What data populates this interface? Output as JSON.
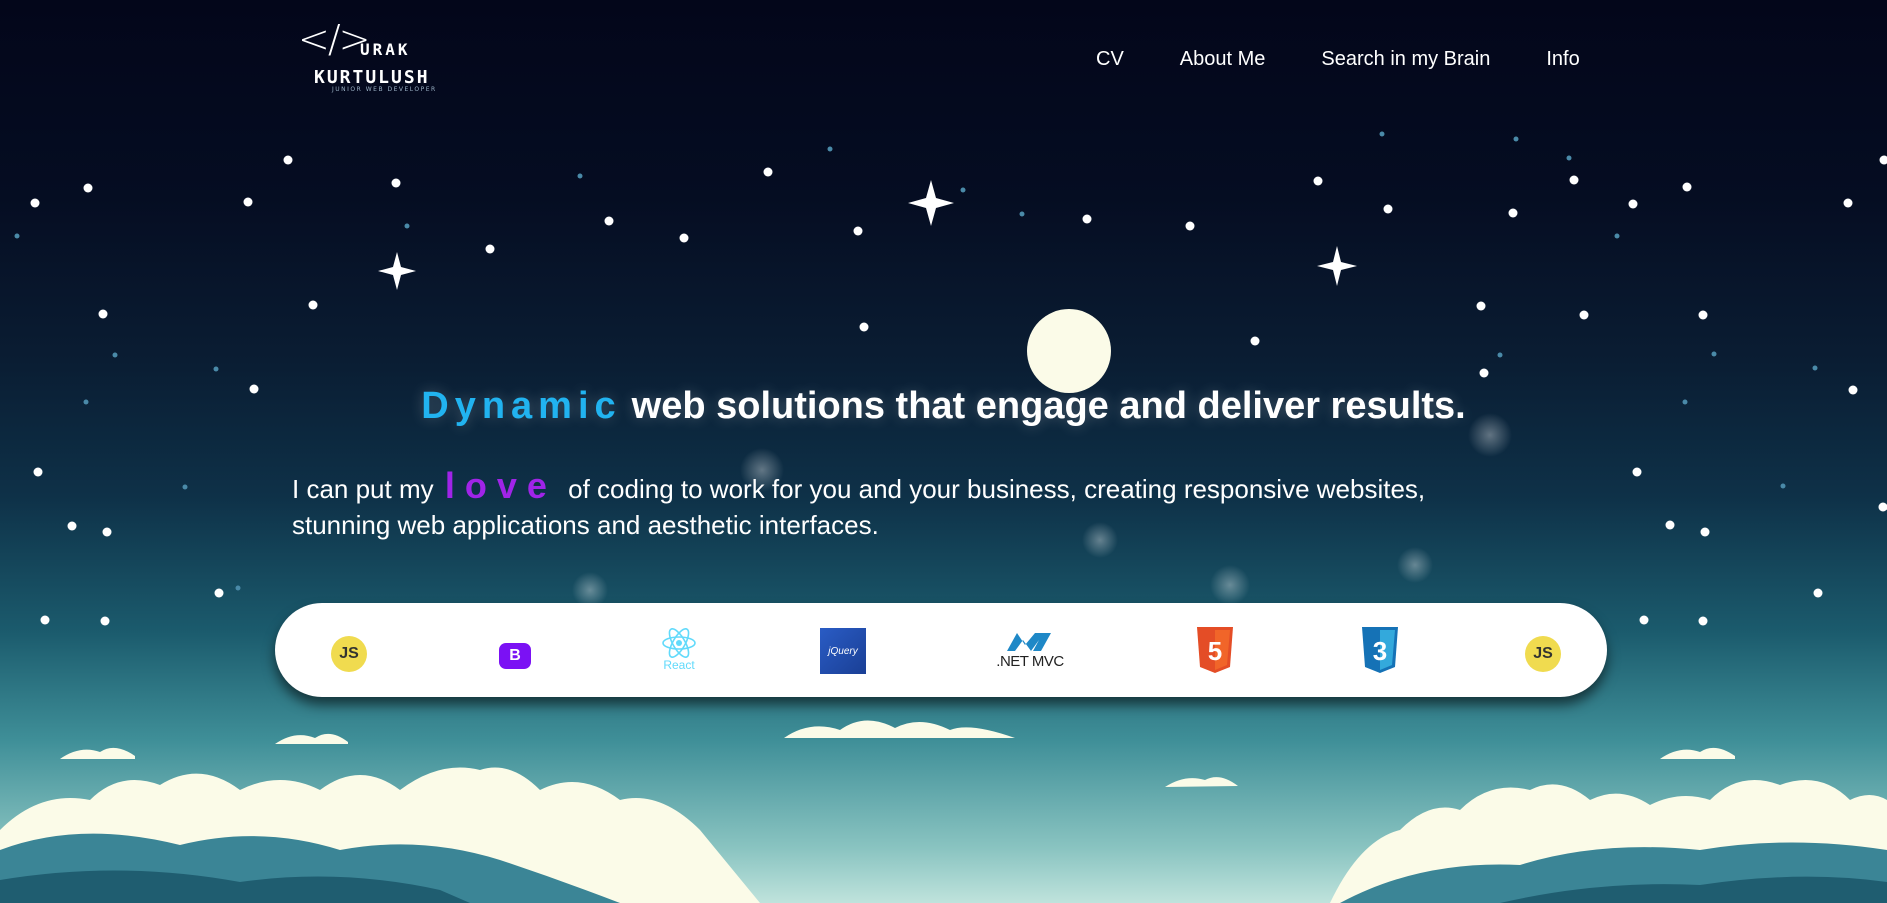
{
  "logo": {
    "mark": "</>",
    "line1": "URAK",
    "line2": "KURTULUSH",
    "tagline": "JUNIOR WEB DEVELOPER"
  },
  "nav": [
    {
      "label": "CV"
    },
    {
      "label": "About Me"
    },
    {
      "label": "Search in my Brain"
    },
    {
      "label": "Info"
    }
  ],
  "hero": {
    "headline_accent": "Dynamic",
    "headline_rest": "web solutions that engage and deliver results.",
    "intro_before": "I can put my",
    "intro_love": "love",
    "intro_after": "of coding to work for you and your business, creating responsive websites, stunning web applications and aesthetic interfaces."
  },
  "tech": [
    {
      "name": "JavaScript",
      "icon": "javascript-icon",
      "text": "JS",
      "color": "#f0db4f"
    },
    {
      "name": "Bootstrap",
      "icon": "bootstrap-icon",
      "text": "B",
      "color": "#7b11f4"
    },
    {
      "name": "React",
      "icon": "react-icon",
      "text": "React",
      "color": "#61dafb"
    },
    {
      "name": "jQuery",
      "icon": "jquery-icon",
      "text": "jQuery",
      "color": "#2a5cc5"
    },
    {
      "name": ".NET MVC",
      "icon": "dotnet-mvc-icon",
      "text": ".NET MVC",
      "color": "#1e88c7"
    },
    {
      "name": "HTML5",
      "icon": "html5-icon",
      "text": "5",
      "color": "#e44d26"
    },
    {
      "name": "CSS3",
      "icon": "css3-icon",
      "text": "3",
      "color": "#1572b6"
    },
    {
      "name": "JavaScript",
      "icon": "javascript-icon",
      "text": "JS",
      "color": "#f0db4f"
    }
  ],
  "colors": {
    "accent_blue": "#21b3f0",
    "accent_purple": "#a024e8"
  }
}
